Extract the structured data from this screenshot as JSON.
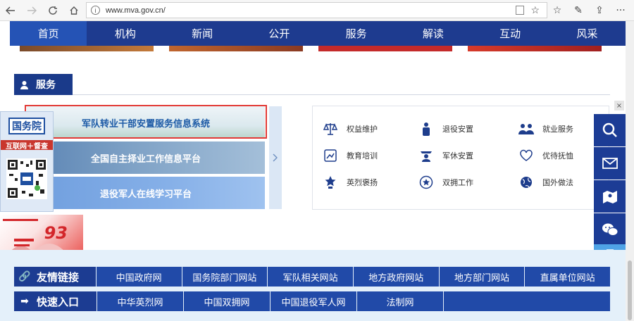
{
  "browser": {
    "url": "www.mva.gov.cn/",
    "back_icon": "arrow-left-icon",
    "forward_icon": "arrow-right-icon",
    "refresh_icon": "refresh-icon",
    "home_icon": "home-icon"
  },
  "nav": {
    "items": [
      "首页",
      "机构",
      "新闻",
      "公开",
      "服务",
      "解读",
      "互动",
      "风采"
    ],
    "active": "首页"
  },
  "services_section": {
    "title": "服务",
    "platforms": [
      "军队转业干部安置服务信息系统",
      "全国自主择业工作信息平台",
      "退役军人在线学习平台"
    ],
    "items": [
      {
        "label": "权益维护",
        "icon": "scales-icon"
      },
      {
        "label": "退役安置",
        "icon": "soldier-icon"
      },
      {
        "label": "就业服务",
        "icon": "people-icon"
      },
      {
        "label": "教育培训",
        "icon": "education-icon"
      },
      {
        "label": "军休安置",
        "icon": "officer-icon"
      },
      {
        "label": "优待抚恤",
        "icon": "heart-hand-icon"
      },
      {
        "label": "英烈褒扬",
        "icon": "medal-icon"
      },
      {
        "label": "双拥工作",
        "icon": "star-badge-icon"
      },
      {
        "label": "国外做法",
        "icon": "globe-icon"
      }
    ]
  },
  "qr_panel": {
    "title": "国务院",
    "label": "互联网＋督查"
  },
  "anniversary": {
    "number": "93"
  },
  "friendly_links": {
    "title": "友情链接",
    "links": [
      "中国政府网",
      "国务院部门网站",
      "军队相关网站",
      "地方政府网站",
      "地方部门网站",
      "直属单位网站"
    ]
  },
  "quick_access": {
    "title": "快速入口",
    "links": [
      "中华英烈网",
      "中国双拥网",
      "中国退役军人网",
      "法制网"
    ]
  },
  "colors": {
    "nav_bg": "#1e3b8f",
    "nav_active": "#2553b5",
    "highlight_box": "#e23a36",
    "float_bar": "#1c3c95"
  }
}
